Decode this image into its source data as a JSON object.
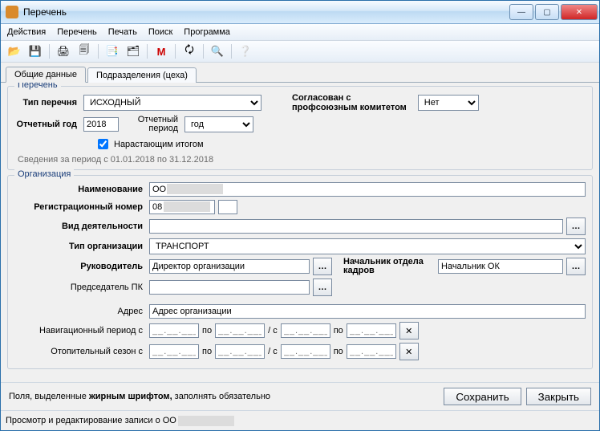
{
  "window": {
    "title": "Перечень"
  },
  "menu": {
    "actions": "Действия",
    "list": "Перечень",
    "print": "Печать",
    "search": "Поиск",
    "program": "Программа"
  },
  "toolbar": {
    "open": "📂",
    "save": "💾",
    "print": "🖨",
    "preview": "🗐",
    "copy": "📑",
    "paste": "🗂",
    "chart": "M",
    "refresh": "🗘",
    "find": "🔍",
    "help": "❔"
  },
  "tabs": {
    "general": "Общие данные",
    "units": "Подразделения (цеха)"
  },
  "group_list": {
    "legend": "Перечень",
    "type_label": "Тип перечня",
    "type_value": "ИСХОДНЫЙ",
    "year_label": "Отчетный год",
    "year_value": "2018",
    "period_label": "Отчетный период",
    "period_value": "год",
    "cumulative_label": "Нарастающим итогом",
    "period_info": "Сведения за период с 01.01.2018 по 31.12.2018",
    "agreed_label1": "Согласован с",
    "agreed_label2": "профсоюзным комитетом",
    "agreed_value": "Нет"
  },
  "group_org": {
    "legend": "Организация",
    "name_label": "Наименование",
    "name_value": "ОО",
    "reg_label": "Регистрационный номер",
    "reg_value": "08",
    "activity_label": "Вид деятельности",
    "activity_value": "",
    "orgtype_label": "Тип организации",
    "orgtype_value": "ТРАНСПОРТ",
    "head_label": "Руководитель",
    "head_value": "Директор организации",
    "hr_label": "Начальник отдела кадров",
    "hr_value": "Начальник ОК",
    "pk_label": "Председатель ПК",
    "pk_value": "",
    "addr_label": "Адрес",
    "addr_value": "Адрес организации",
    "nav_label": "Навигационный период с",
    "to": "по",
    "slash": "/ с",
    "heat_label": "Отопительный сезон с",
    "date_ph": "__.__.____"
  },
  "footer": {
    "hint_pre": "Поля, выделенные ",
    "hint_bold": "жирным шрифтом,",
    "hint_post": " заполнять обязательно",
    "save": "Сохранить",
    "close": "Закрыть"
  },
  "status": {
    "prefix": "Просмотр и редактирование записи о ОО"
  }
}
